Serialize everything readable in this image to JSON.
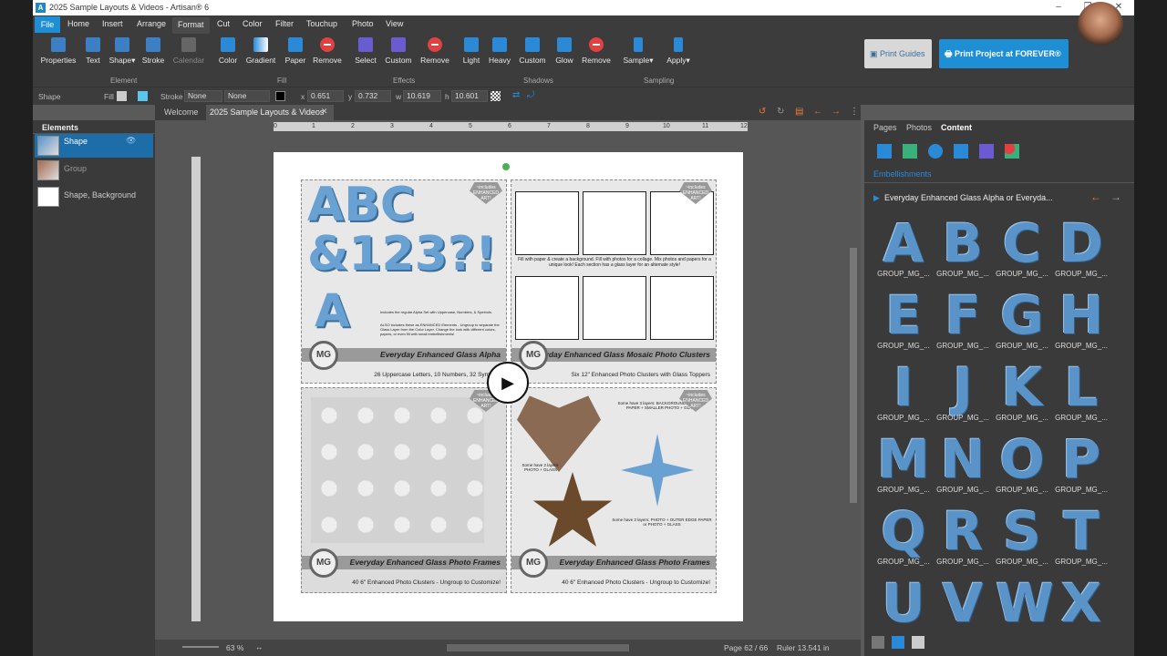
{
  "window": {
    "title": "2025 Sample Layouts & Videos - Artisan® 6",
    "app_icon": "A"
  },
  "menu": {
    "file": "File",
    "items": [
      "Home",
      "Insert",
      "Arrange",
      "Format",
      "Cut",
      "Color",
      "Filter",
      "Touchup",
      "Photo",
      "View"
    ],
    "active": "Format"
  },
  "ribbon": {
    "tools": [
      "Properties",
      "Text",
      "Shape",
      "Stroke",
      "Calendar",
      "Color",
      "Gradient",
      "Paper",
      "Remove",
      "Select",
      "Custom",
      "Remove",
      "Light",
      "Heavy",
      "Custom",
      "Glow",
      "Remove",
      "Sample",
      "Apply"
    ],
    "groups": [
      "Element",
      "Fill",
      "Effects",
      "Shadows",
      "Sampling"
    ],
    "print_guides": "Print Guides",
    "print_project": "Print Project at FOREVER®"
  },
  "propbar": {
    "shape": "Shape",
    "fill": "Fill",
    "stroke": "Stroke",
    "stroke_val1": "None",
    "stroke_val2": "None",
    "x_label": "x",
    "x": "0.651",
    "y_label": "y",
    "y": "0.732",
    "w_label": "w",
    "w": "10.619",
    "h_label": "h",
    "h": "10.601"
  },
  "tabs": {
    "welcome": "Welcome",
    "doc": "2025 Sample Layouts & Videos"
  },
  "left": {
    "title": "Elements",
    "items": [
      "Shape",
      "Group",
      "Shape, Background"
    ]
  },
  "ruler": {
    "ticks": [
      "0",
      "1",
      "2",
      "3",
      "4",
      "5",
      "6",
      "7",
      "8",
      "9",
      "10",
      "11",
      "12"
    ]
  },
  "page": {
    "q1": {
      "title": "Everyday Enhanced Glass Alpha",
      "sub": "26 Uppercase Letters, 10 Numbers, 32 Symbols",
      "big": "ABC &123?!",
      "letter": "A",
      "note1": "Includes the regular Alpha Set with Uppercase, Numbers, & Symbols.",
      "note2": "ALSO includes these as ENHANCED Elements - Ungroup to separate the Glass Layer from the Color Layer. Change the look with different colors, papers, or even fill with small embellishments!"
    },
    "q2": {
      "title": "Everyday Enhanced Glass Mosaic Photo Clusters",
      "sub": "Six 12\" Enhanced Photo Clusters with Glass Toppers",
      "note": "Fill with paper & create a background. Fill with photos for a collage. Mix photos and papers for a unique look! Each section has a glass layer for an alternate style!"
    },
    "q3": {
      "title": "Everyday Enhanced Glass Photo Frames",
      "sub": "40 6\" Enhanced Photo Clusters - Ungroup to Customize!"
    },
    "q4": {
      "title": "Everyday Enhanced Glass Photo Frames",
      "sub": "40 6\" Enhanced Photo Clusters - Ungroup to Customize!",
      "note1": "Some have 3 layers: BACKGROUND PHOTO or PAPER + SMALLER PHOTO + GLASS",
      "note2": "Some have 2 layers: PHOTO + GLASS",
      "note3": "Some have 3 layers: PHOTO + OUTER EDGE PAPER or PHOTO + GLASS"
    },
    "badge": "~includes ENHANCED ART!",
    "mg": "MG"
  },
  "status": {
    "zoom": "63 %",
    "page": "Page 62 / 66",
    "ruler": "Ruler 13.541 in"
  },
  "right": {
    "tabs": [
      "Pages",
      "Photos",
      "Content"
    ],
    "section": "Embellishments",
    "folder": "Everyday Enhanced Glass Alpha or Everyda...",
    "glyphs": [
      "A",
      "B",
      "C",
      "D",
      "E",
      "F",
      "G",
      "H",
      "I",
      "J",
      "K",
      "L",
      "M",
      "N",
      "O",
      "P",
      "Q",
      "R",
      "S",
      "T",
      "U",
      "V",
      "W",
      "X"
    ],
    "caption": "GROUP_MG_..."
  },
  "colors": {
    "accent": "#1e8fd5",
    "glyph": "#5a93c8",
    "remove": "#e04141"
  }
}
